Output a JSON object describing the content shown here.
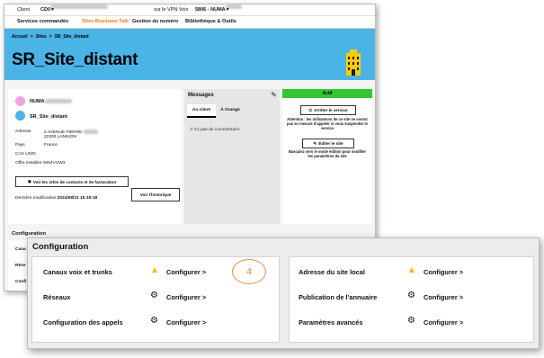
{
  "topbar": {
    "client_label": "Client",
    "client_value": "CD0",
    "voip_label": "sur le VPN Voix",
    "voip_value": "5806 - NUMA"
  },
  "nav": {
    "items": [
      {
        "label": "Services commandés"
      },
      {
        "label": "Sites Business Talk"
      },
      {
        "label": "Gestion du numéro"
      },
      {
        "label": "Bibliothèque & Outils"
      }
    ]
  },
  "breadcrumb": {
    "items": [
      "Accueil",
      "Sites",
      "SR_Site_distant"
    ],
    "sep": ">"
  },
  "page_title": "SR_Site_distant",
  "info": {
    "account_name": "NUMA",
    "site_name": "SR_Site_distant",
    "address_label": "Adresse",
    "address_line1": "2 AVENUE PIERRE",
    "address_line2": "22300 LANNION",
    "country_label": "Pays",
    "country_value": "France",
    "cas_label": "CAS USID",
    "offer_label": "Offre installée",
    "offer_value": "0054VUW3",
    "contacts_button": "Voir les infos de contacts et de facturation",
    "last_modified_label": "Dernière modification",
    "last_modified_value": "2024/08/21 15:19:18",
    "history_button": "Voir l'historique"
  },
  "messages": {
    "title": "Messages",
    "tabs": [
      "Au client",
      "À Orange"
    ],
    "empty_text": "Il n'y pas de commentaire"
  },
  "status": {
    "badge": "Actif",
    "badge_color": "#32c832",
    "stop_button": "Arrêter le service",
    "stop_note": "Attention : les utilisateurs de ce site ne seront pas en mesure d'appeler si vous suspendez le service",
    "edit_button": "Éditer le site",
    "edit_note": "Basculez vers le mode édition pour modifier les paramètres du site"
  },
  "config_bg": {
    "title": "Configuration",
    "items": [
      "Cana",
      "Rése",
      "Confi"
    ]
  },
  "config": {
    "title": "Configuration",
    "left": [
      {
        "label": "Canaux voix et trunks",
        "icon": "warning-icon",
        "link": "Configurer >"
      },
      {
        "label": "Réseaux",
        "icon": "gear-icon",
        "link": "Configurer >"
      },
      {
        "label": "Configuration des appels",
        "icon": "gear-icon",
        "link": "Configurer >"
      }
    ],
    "right": [
      {
        "label": "Adresse du site local",
        "icon": "warning-icon",
        "link": "Configurer >"
      },
      {
        "label": "Publication de l'annuaire",
        "icon": "gear-icon",
        "link": "Configurer >"
      },
      {
        "label": "Paramètres avancés",
        "icon": "gear-icon",
        "link": "Configurer >"
      }
    ]
  },
  "annotation_number": "4",
  "colors": {
    "banner": "#4bb4e6",
    "accent": "#ff7900",
    "warning": "#f5b800"
  }
}
